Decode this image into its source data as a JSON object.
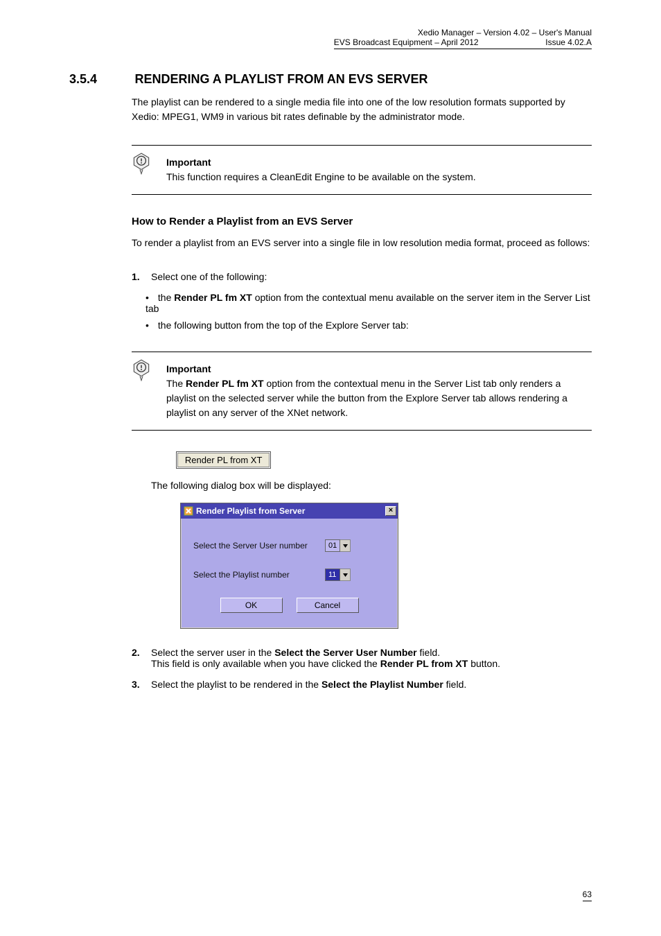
{
  "header": {
    "line1": "Xedio Manager – Version 4.02 – User's Manual",
    "line2": "EVS Broadcast Equipment – April 2012",
    "issue": "Issue 4.02.A"
  },
  "section": {
    "number": "3.5.4",
    "heading": "RENDERING A PLAYLIST FROM AN EVS SERVER"
  },
  "intro": "The playlist can be rendered to a single media file into one of the low resolution formats supported by Xedio: MPEG1, WM9 in various bit rates definable by the administrator mode.",
  "note1": "This function requires a CleanEdit Engine to be available on the system.",
  "sub_heading": "How to Render a Playlist from an EVS Server",
  "step1_intro": "To render a playlist from an EVS server into a single file in low resolution media format, proceed as follows:",
  "list1_a_prefix": "the ",
  "list1_a_label": "Render PL fm XT",
  "list1_a_suffix": " option from the contextual menu available on the server item in the Server List tab",
  "list1_b": "the following button from the top of the Explore Server tab: ",
  "note2_a": "The ",
  "note2_b": " option from the contextual menu in the Server List tab only renders a playlist on the selected server while the button from the Explore Server tab allows rendering a playlist on any server of the XNet network.",
  "step1": "Select one of the following:",
  "button_label": "Render PL from XT",
  "dialog_intro": "The following dialog box will be displayed:",
  "dialog": {
    "title": "Render Playlist from Server",
    "label_user": "Select the Server User number",
    "value_user": "01",
    "label_pl": "Select the Playlist number",
    "value_pl": "11",
    "ok": "OK",
    "cancel": "Cancel"
  },
  "step2_a": "Select the server user in the ",
  "step2_field": "Select the Server User Number",
  "step2_b": " field.",
  "step2_c": "This field is only available when you have clicked the ",
  "step2_d": " button.",
  "step3_a": "Select the playlist to be rendered in the ",
  "step3_field": "Select the Playlist Number",
  "step3_b": " field.",
  "footer_page": "63"
}
